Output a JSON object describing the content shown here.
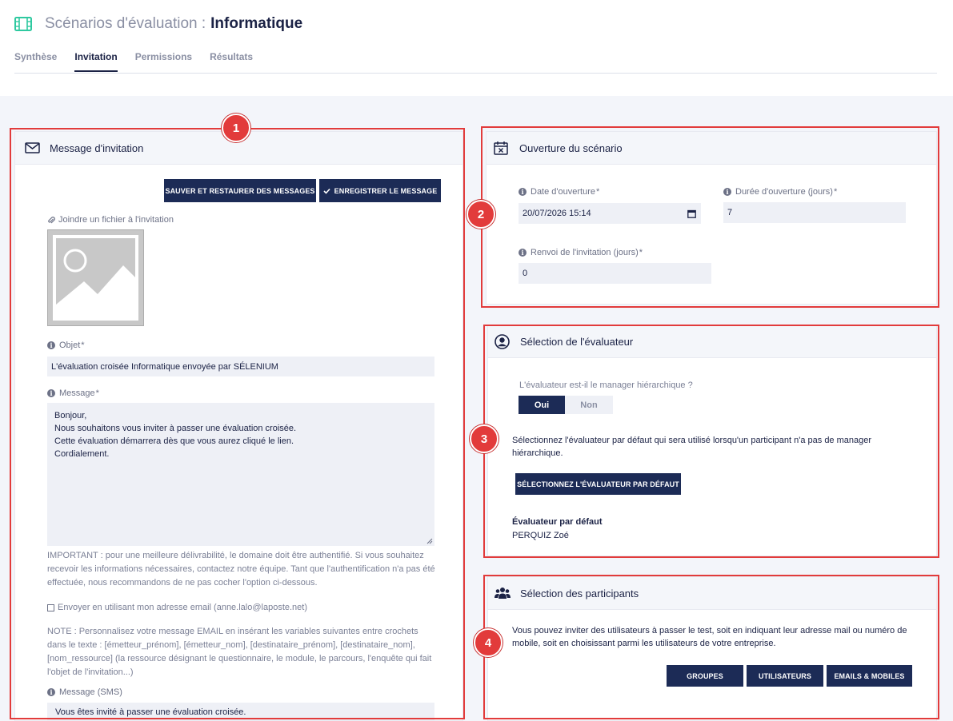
{
  "header": {
    "title_prefix": "Scénarios d'évaluation :",
    "title_name": "Informatique",
    "tabs": [
      {
        "label": "Synthèse",
        "active": false
      },
      {
        "label": "Invitation",
        "active": true
      },
      {
        "label": "Permissions",
        "active": false
      },
      {
        "label": "Résultats",
        "active": false
      }
    ]
  },
  "annotations": {
    "b1": "1",
    "b2": "2",
    "b3": "3",
    "b4": "4"
  },
  "invitation": {
    "title": "Message d'invitation",
    "save_restore_label": "SAUVER ET RESTAURER DES MESSAGES",
    "save_message_label": "ENREGISTRER LE MESSAGE",
    "attach_label": "Joindre un fichier à l'invitation",
    "subject_label": "Objet",
    "subject_value": "L'évaluation croisée Informatique envoyée par SÉLENIUM",
    "message_label": "Message",
    "message_value": "Bonjour,\nNous souhaitons vous inviter à passer une évaluation croisée.\nCette évaluation démarrera dès que vous aurez cliqué le lien.\nCordialement.",
    "important_note": "IMPORTANT : pour une meilleure délivrabilité, le domaine doit être authentifié. Si vous souhaitez recevoir les informations nécessaires, contactez notre équipe. Tant que l'authentification n'a pas été effectuée, nous recommandons de ne pas cocher l'option ci-dessous.",
    "send_own_label": "Envoyer en utilisant mon adresse email (anne.lalo@laposte.net)",
    "variables_note": "NOTE : Personnalisez votre message EMAIL en insérant les variables suivantes entre crochets dans le texte : [émetteur_prénom], [émetteur_nom], [destinataire_prénom], [destinataire_nom], [nom_ressource] (la ressource désignant le questionnaire, le module, le parcours, l'enquête qui fait l'objet de l'invitation...)",
    "sms_label": "Message (SMS)",
    "sms_value": "Vous êtes invité à passer une évaluation croisée."
  },
  "opening": {
    "title": "Ouverture du scénario",
    "date_label": "Date d'ouverture",
    "date_value": "20/07/2026 15:14",
    "duration_label": "Durée d'ouverture (jours)",
    "duration_value": "7",
    "resend_label": "Renvoi de l'invitation (jours)",
    "resend_value": "0"
  },
  "evaluator": {
    "title": "Sélection de l'évaluateur",
    "question": "L'évaluateur est-il le manager hiérarchique ?",
    "yes_label": "Oui",
    "no_label": "Non",
    "description": "Sélectionnez l'évaluateur par défaut qui sera utilisé lorsqu'un participant n'a pas de manager hiérarchique.",
    "select_default_label": "SÉLECTIONNEZ L'ÉVALUATEUR PAR DÉFAUT",
    "default_heading": "Évaluateur par défaut",
    "default_name": "PERQUIZ Zoé"
  },
  "participants": {
    "title": "Sélection des participants",
    "description": "Vous pouvez inviter des utilisateurs à passer le test, soit en indiquant leur adresse mail ou numéro de mobile, soit en choisissant parmi les utilisateurs de votre entreprise.",
    "groups_label": "GROUPES",
    "users_label": "UTILISATEURS",
    "emails_label": "EMAILS & MOBILES"
  },
  "colors": {
    "accent": "#1c2b56",
    "annotation": "#e23b3b",
    "icon_green": "#2ec9a0"
  }
}
